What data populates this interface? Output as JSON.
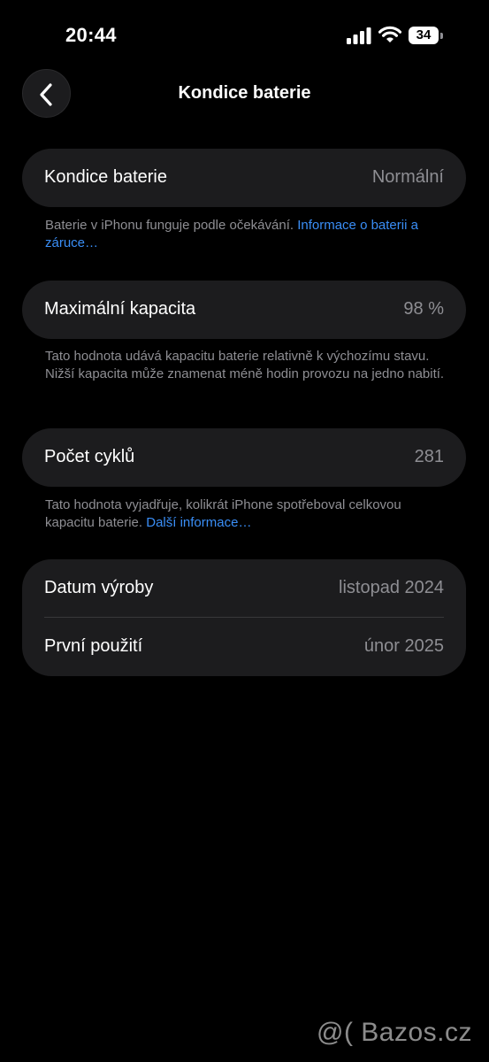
{
  "status_bar": {
    "time": "20:44",
    "battery_level": "34",
    "signal_icon": "cellular-signal-icon",
    "wifi_icon": "wifi-icon",
    "battery_icon": "battery-icon"
  },
  "nav": {
    "title": "Kondice baterie",
    "back_icon": "chevron-left-icon"
  },
  "health": {
    "label": "Kondice baterie",
    "value": "Normální",
    "footnote_text": "Baterie v iPhonu funguje podle očekávání. ",
    "footnote_link": "Informace o baterii a záruce…"
  },
  "capacity": {
    "label": "Maximální kapacita",
    "value": "98 %",
    "footnote_text": "Tato hodnota udává kapacitu baterie relativně k výchozímu stavu. Nižší kapacita může znamenat méně hodin provozu na jedno nabití."
  },
  "cycles": {
    "label": "Počet cyklů",
    "value": "281",
    "footnote_text": "Tato hodnota vyjadřuje, kolikrát iPhone spotřeboval celkovou kapacitu baterie. ",
    "footnote_link": "Další informace…"
  },
  "dates": {
    "manufacture_label": "Datum výroby",
    "manufacture_value": "listopad 2024",
    "first_use_label": "První použití",
    "first_use_value": "únor 2025"
  },
  "watermark": "@( Bazos.cz",
  "colors": {
    "background": "#000000",
    "card": "#1c1c1e",
    "secondary_text": "#8e8e93",
    "link": "#3a8ef6"
  }
}
